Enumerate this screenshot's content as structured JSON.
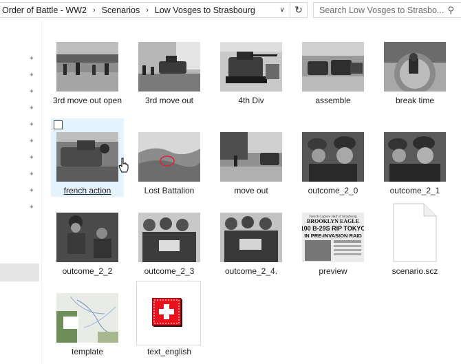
{
  "breadcrumb": [
    "Order of Battle - WW2",
    "Scenarios",
    "Low Vosges to Strasbourg"
  ],
  "search": {
    "placeholder": "Search Low Vosges to Strasbo..."
  },
  "files": [
    {
      "name": "3rd move out open",
      "kind": "photo"
    },
    {
      "name": "3rd move out",
      "kind": "photo"
    },
    {
      "name": "4th Div",
      "kind": "photo"
    },
    {
      "name": "assemble",
      "kind": "photo"
    },
    {
      "name": "break time",
      "kind": "photo"
    },
    {
      "name": "french action",
      "kind": "photo",
      "selected": true
    },
    {
      "name": "Lost Battalion",
      "kind": "photo"
    },
    {
      "name": "move out",
      "kind": "photo"
    },
    {
      "name": "outcome_2_0",
      "kind": "photo"
    },
    {
      "name": "outcome_2_1",
      "kind": "photo"
    },
    {
      "name": "outcome_2_2",
      "kind": "photo"
    },
    {
      "name": "outcome_2_3",
      "kind": "photo"
    },
    {
      "name": "outcome_2_4.",
      "kind": "photo"
    },
    {
      "name": "preview",
      "kind": "newspaper",
      "paper": {
        "kicker": "French Capture Half of Strasbourg",
        "masthead": "BROOKLYN EAGLE",
        "headline1": "100 B-29S RIP TOKYO",
        "headline2": "IN PRE-INVASION RAID"
      }
    },
    {
      "name": "scenario.scz",
      "kind": "document"
    },
    {
      "name": "template",
      "kind": "map"
    },
    {
      "name": "text_english",
      "kind": "swiss-file"
    }
  ],
  "colors": {
    "selection": "#e5f3ff",
    "swiss_red": "#e8111c"
  }
}
